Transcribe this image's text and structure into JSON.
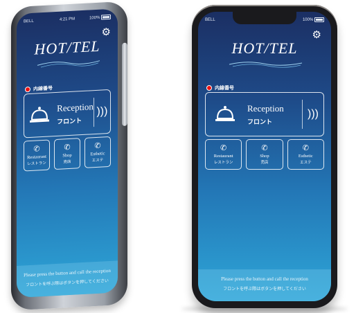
{
  "status": {
    "carrier": "BELL",
    "time": "4:21 PM",
    "battery": "100%"
  },
  "brand": {
    "logo": "HOT/TEL"
  },
  "extension_label": "内線番号",
  "reception": {
    "title_en": "Reception",
    "title_jp": "フロント"
  },
  "buttons": [
    {
      "en": "Restaurant",
      "jp": "レストラン"
    },
    {
      "en": "Shop",
      "jp": "売店"
    },
    {
      "en": "Esthetic",
      "jp": "エステ"
    }
  ],
  "footer": {
    "en": "Please press the button and call the reception",
    "jp": "フロントを呼ぶ際はボタンを押してください"
  }
}
